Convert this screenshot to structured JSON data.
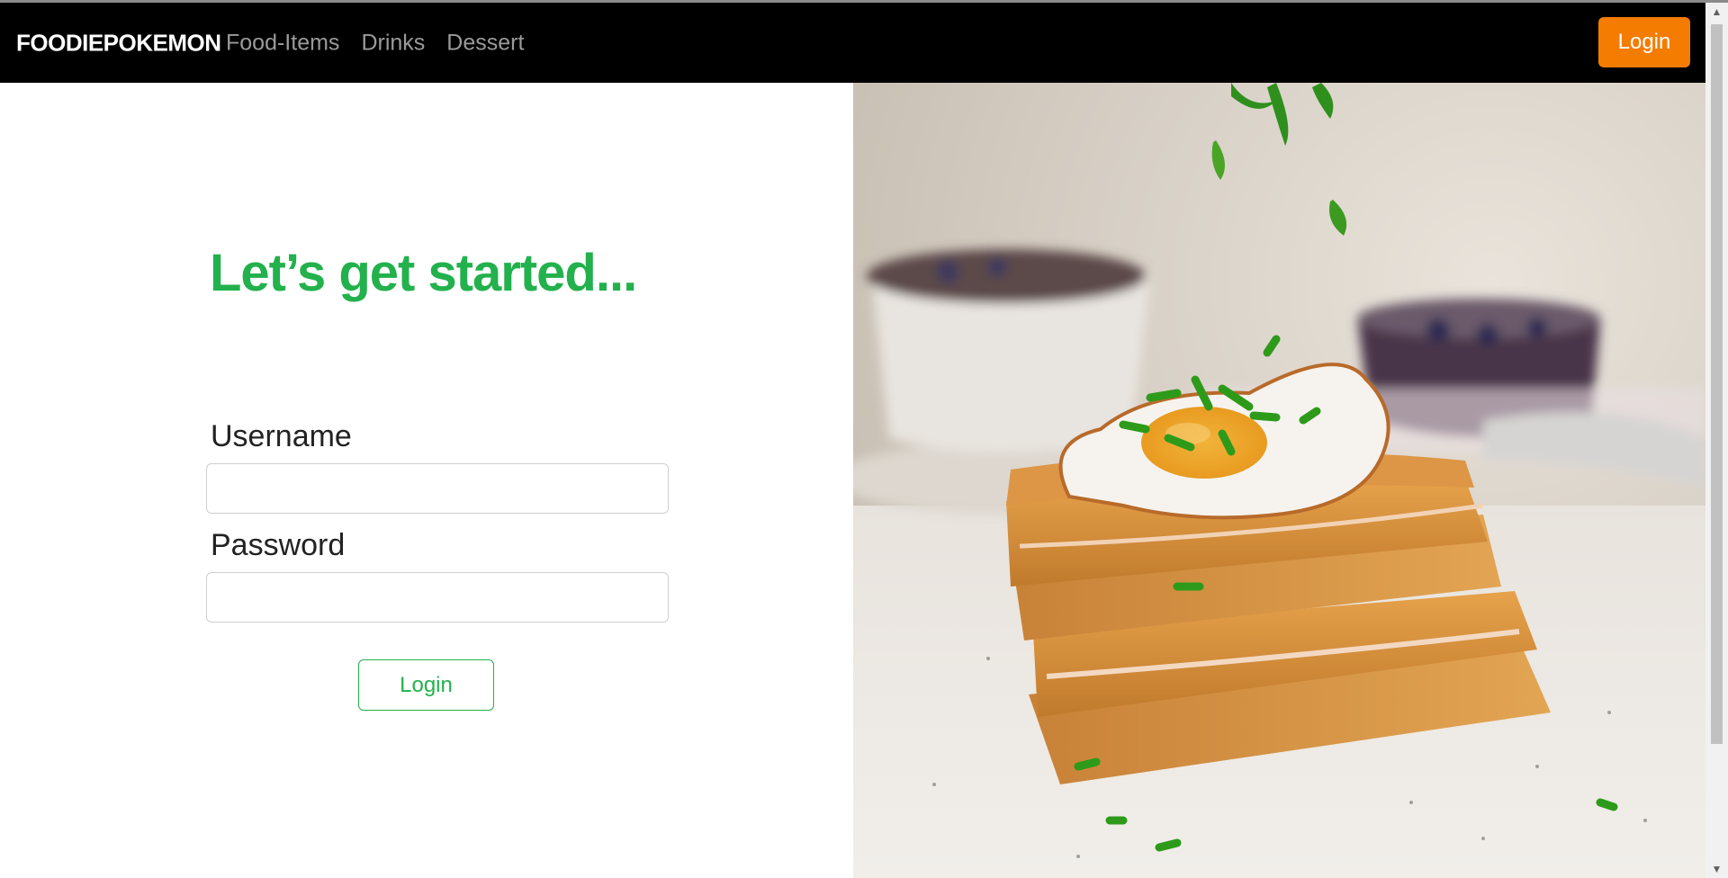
{
  "navbar": {
    "brand": "FOODIEPOKEMON",
    "links": [
      "Food-Items",
      "Drinks",
      "Dessert"
    ],
    "login_label": "Login",
    "login_color": "#f47c00"
  },
  "form": {
    "heading": "Let’s get started...",
    "username_label": "Username",
    "password_label": "Password",
    "submit_label": "Login",
    "accent_color": "#22b14c"
  },
  "hero": {
    "icon": "food-photo-egg-toast"
  },
  "scrollbar": {
    "up_icon": "scroll-up-arrow-icon",
    "down_icon": "scroll-down-arrow-icon"
  }
}
